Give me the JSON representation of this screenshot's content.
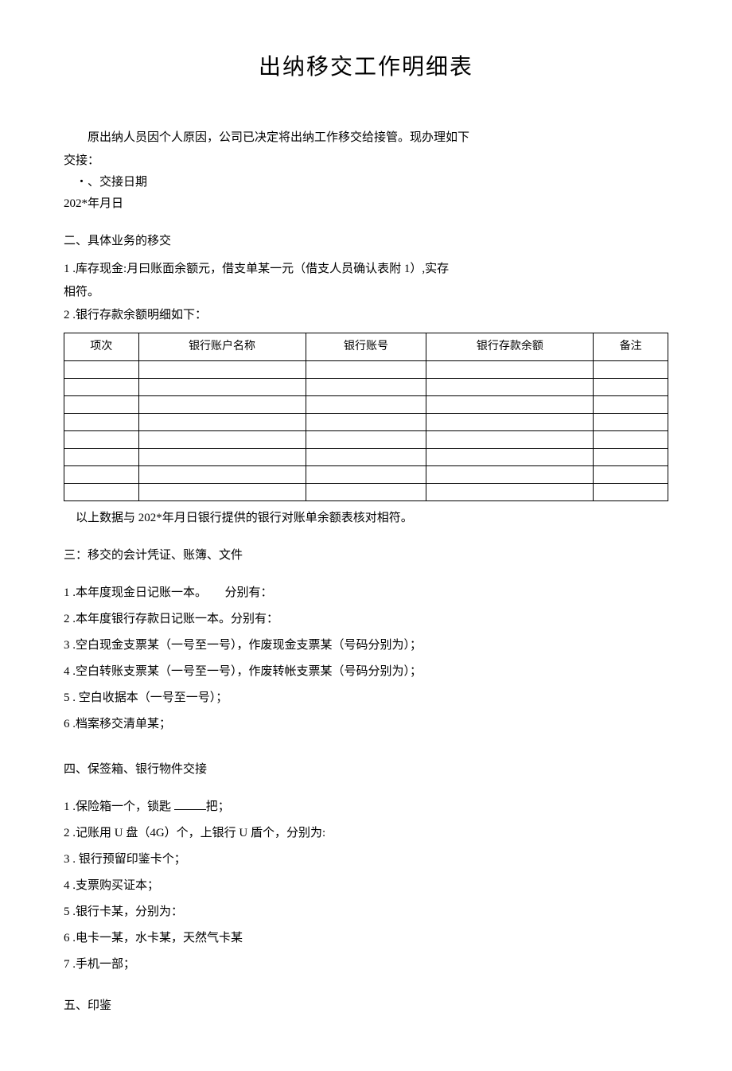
{
  "title": "出纳移交工作明细表",
  "intro": "原出纳人员因个人原因，公司已决定将出纳工作移交给接管。现办理如下",
  "intro2": "交接：",
  "section1_label": "・、交接日期",
  "date_line": "202*年月日",
  "section2_heading": "二、具体业务的移交",
  "section2_item1": "1 .库存现金:月曰账面余额元，借支单某一元（借支人员确认表附 1）,实存",
  "section2_item1b": "相符。",
  "section2_item2": "2 .银行存款余额明细如下：",
  "table": {
    "headers": [
      "项次",
      "银行账户名称",
      "银行账号",
      "银行存款余额",
      "备注"
    ]
  },
  "table_note": "以上数据与 202*年月日银行提供的银行对账单余额表核对相符。",
  "section3_heading": "三：移交的会计凭证、账簿、文件",
  "section3_items": [
    "1 .本年度现金日记账一本。　　分别有：",
    "2 .本年度银行存款日记账一本。分别有：",
    "3 .空白现金支票某（一号至一号），作废现金支票某（号码分别为）；",
    "4 .空白转账支票某（一号至一号），作废转帐支票某（号码分别为）；",
    "5 . 空白收据本（一号至一号）；",
    "6 .档案移交清单某；"
  ],
  "section4_heading": "四、保签箱、银行物件交接",
  "section4_item1_pre": "1 .保险箱一个，锁匙 ",
  "section4_item1_post": "把；",
  "section4_items_rest": [
    "2 .记账用 U 盘（4G）个，上银行 U 盾个，分别为:",
    "3 . 银行预留印鉴卡个；",
    "4 .支票购买证本；",
    "5 .银行卡某，分别为：",
    "6 .电卡一某，水卡某，天然气卡某",
    "7 .手机一部；"
  ],
  "section5_heading": "五、印鉴"
}
